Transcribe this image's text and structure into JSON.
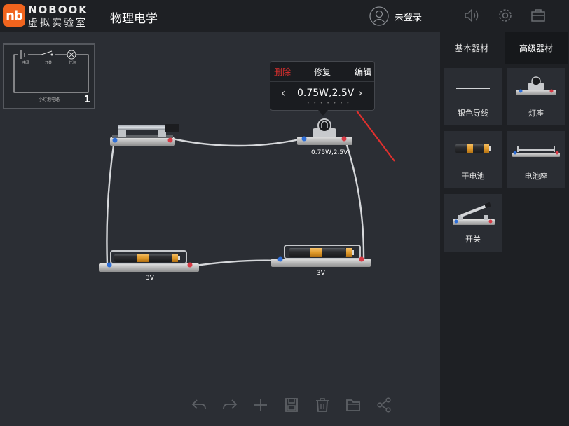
{
  "header": {
    "logo_badge": "nb",
    "logo_en": "NOBOOK",
    "logo_cn": "虚拟实验室",
    "title": "物理电学",
    "login_text": "未登录",
    "icons": [
      "sound-icon",
      "settings-icon",
      "toolbox-icon"
    ]
  },
  "sidebar": {
    "tabs": [
      {
        "label": "基本器材",
        "active": false
      },
      {
        "label": "高级器材",
        "active": true
      }
    ],
    "items": [
      {
        "label": "银色导线",
        "icon": "wire-icon"
      },
      {
        "label": "灯座",
        "icon": "lamp-holder-icon"
      },
      {
        "label": "干电池",
        "icon": "battery-icon"
      },
      {
        "label": "电池座",
        "icon": "battery-holder-icon"
      },
      {
        "label": "开关",
        "icon": "switch-icon"
      }
    ]
  },
  "thumbnail": {
    "caption": "小灯泡电路",
    "number": "1",
    "labels": [
      "电源",
      "开关",
      "灯泡"
    ]
  },
  "components": {
    "lamp_label": "0.75W,2.5V",
    "battery1_label": "3V",
    "battery2_label": "3V"
  },
  "popup": {
    "delete": "删除",
    "repair": "修复",
    "edit": "编辑",
    "value": "0.75W,2.5V",
    "prev": "‹",
    "next": "›",
    "dots": "• • • • • • •"
  },
  "toolbar": {
    "icons": [
      "undo-icon",
      "redo-icon",
      "add-icon",
      "save-icon",
      "delete-icon",
      "folder-icon",
      "share-icon"
    ]
  },
  "colors": {
    "accent": "#f0641e",
    "background": "#2b2e34",
    "panel": "#1e2024",
    "delete": "#e0302e",
    "arrow": "#e0302e"
  }
}
